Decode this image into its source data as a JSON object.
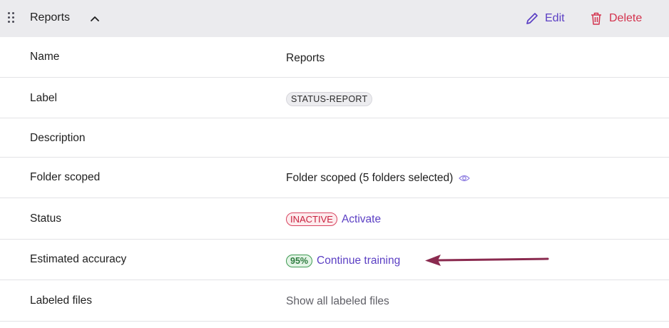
{
  "header": {
    "title": "Reports",
    "edit_label": "Edit",
    "delete_label": "Delete"
  },
  "rows": [
    {
      "label": "Name",
      "value": "Reports"
    },
    {
      "label": "Label",
      "value": "STATUS-REPORT"
    },
    {
      "label": "Description",
      "value": ""
    },
    {
      "label": "Folder scoped",
      "value": "Folder scoped (5 folders selected)"
    },
    {
      "label": "Status",
      "badge": "INACTIVE",
      "action": "Activate"
    },
    {
      "label": "Estimated accuracy",
      "badge": "95%",
      "action": "Continue training"
    },
    {
      "label": "Labeled files",
      "value": "Show all labeled files"
    }
  ],
  "colors": {
    "accent": "#5b3fc4",
    "danger": "#d3324d",
    "success": "#3e9a52",
    "annotation_arrow": "#8a2a4f"
  },
  "icons": [
    "drag-handle-icon",
    "chevron-up-icon",
    "pencil-icon",
    "trash-icon",
    "eye-icon",
    "arrow-left-icon"
  ]
}
